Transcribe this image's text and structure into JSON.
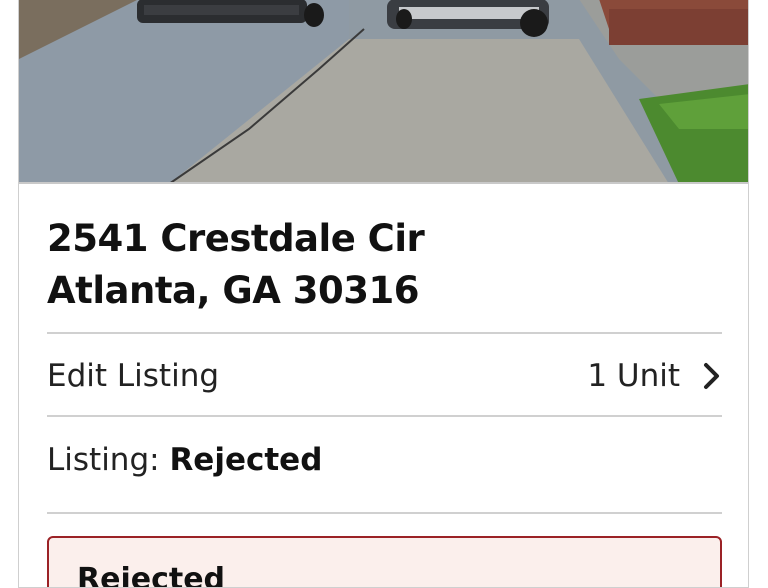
{
  "listing": {
    "address_line1": "2541 Crestdale Cir",
    "address_line2": "Atlanta, GA 30316",
    "edit_label": "Edit Listing",
    "units_label": "1 Unit",
    "status_label": "Listing:",
    "status_value": "Rejected"
  },
  "alert": {
    "title": "Rejected"
  },
  "icons": {
    "edit_chevron": "chevron-right-icon"
  },
  "colors": {
    "alert_border": "#9b2226",
    "alert_background": "#fbefec",
    "divider": "#d0d0d0"
  }
}
